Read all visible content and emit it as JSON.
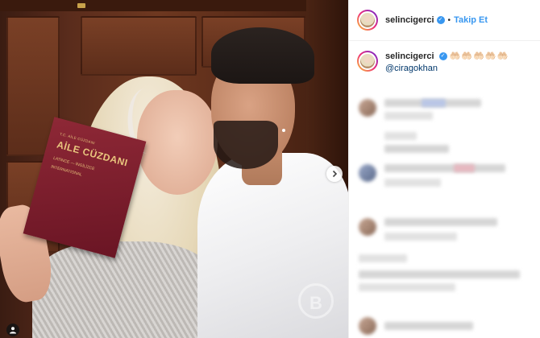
{
  "post": {
    "author": {
      "username": "selincigerci",
      "verified": true
    },
    "follow_label": "Takip Et",
    "separator": "•",
    "photo": {
      "booklet": {
        "small_text": "T.C. AİLE CÜZDANI",
        "title": "AİLE CÜZDANI",
        "line1": "LATİNCE — İNGİLİZCE",
        "line2": "INTERNATIONAL"
      },
      "watermark": "B"
    },
    "caption": {
      "username": "selincigerci",
      "emojis": "🤲🏻🤲🏻🤲🏻🤲🏻🤲🏻",
      "mention": "@ciragokhan"
    },
    "comments_blurred": true
  },
  "icons": {
    "verified": "verified-badge-icon",
    "next": "chevron-right-icon",
    "user_tags": "user-tag-icon"
  },
  "colors": {
    "accent": "#3897f0",
    "mention": "#00376b",
    "text": "#262626"
  }
}
